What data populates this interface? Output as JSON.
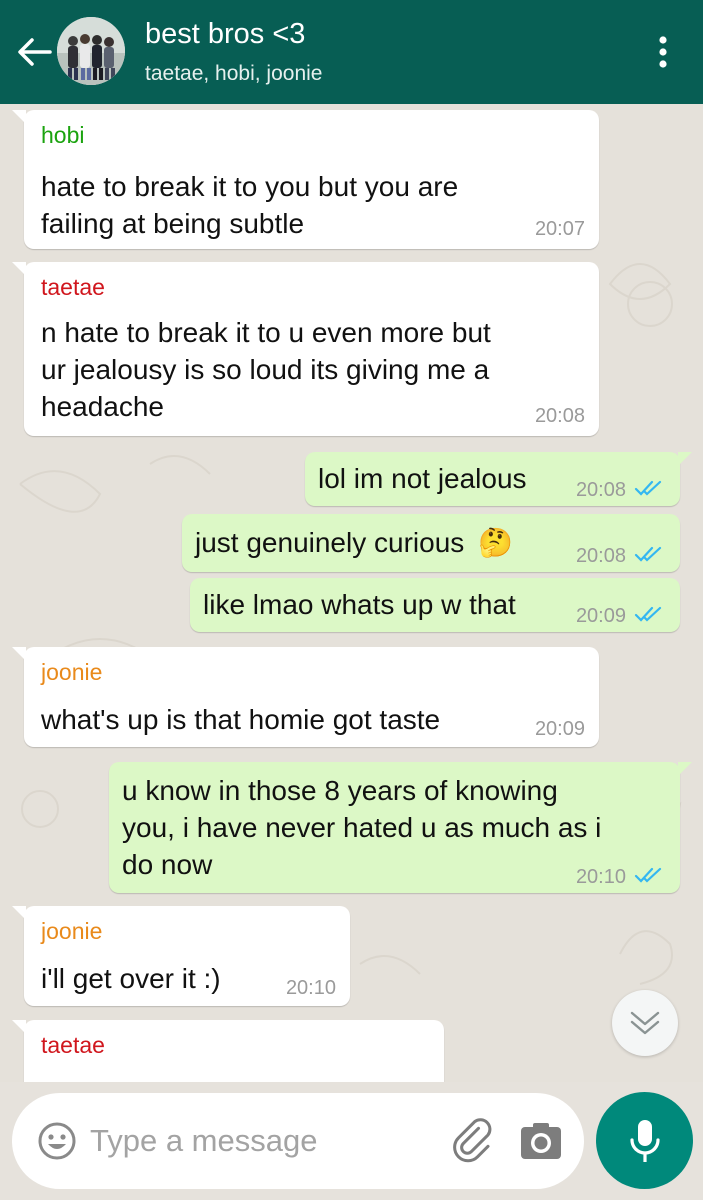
{
  "header": {
    "title": "best bros <3",
    "subtitle": "taetae, hobi, joonie"
  },
  "colors": {
    "header_bg": "#075e54",
    "incoming_bubble": "#ffffff",
    "outgoing_bubble": "#dcf8c6",
    "read_ticks": "#34b7f1",
    "mic_button": "#00897b",
    "sender_hobi": "#1ba30f",
    "sender_taetae": "#d0161d",
    "sender_joonie": "#e98a1b"
  },
  "messages": [
    {
      "direction": "in",
      "sender": "hobi",
      "lines": [
        "hate to break it to you but you are",
        "failing at being subtle"
      ],
      "time": "20:07"
    },
    {
      "direction": "in",
      "sender": "taetae",
      "lines": [
        "n hate to break it to u even more but",
        "ur jealousy is so loud its giving me a",
        "headache"
      ],
      "time": "20:08"
    },
    {
      "direction": "out",
      "lines": [
        "lol im not jealous"
      ],
      "time": "20:08",
      "status": "read"
    },
    {
      "direction": "out",
      "lines": [
        "just genuinely curious"
      ],
      "emoji": "🤔",
      "time": "20:08",
      "status": "read"
    },
    {
      "direction": "out",
      "lines": [
        "like lmao whats up w that"
      ],
      "time": "20:09",
      "status": "read"
    },
    {
      "direction": "in",
      "sender": "joonie",
      "lines": [
        "what's up is that homie got taste"
      ],
      "time": "20:09"
    },
    {
      "direction": "out",
      "lines": [
        "u know in those 8 years of knowing",
        "you, i have never hated u as much as i",
        "do now"
      ],
      "time": "20:10",
      "status": "read"
    },
    {
      "direction": "in",
      "sender": "joonie",
      "lines": [
        "i'll get over it :)"
      ],
      "time": "20:10"
    },
    {
      "direction": "in",
      "sender": "taetae",
      "lines": [],
      "time": ""
    }
  ],
  "input": {
    "placeholder": "Type a message"
  },
  "icons": {
    "back": "back-arrow-icon",
    "menu": "more-vert-icon",
    "scroll": "chevron-double-down-icon",
    "emoji": "emoji-icon",
    "attach": "paperclip-icon",
    "camera": "camera-icon",
    "mic": "microphone-icon"
  }
}
